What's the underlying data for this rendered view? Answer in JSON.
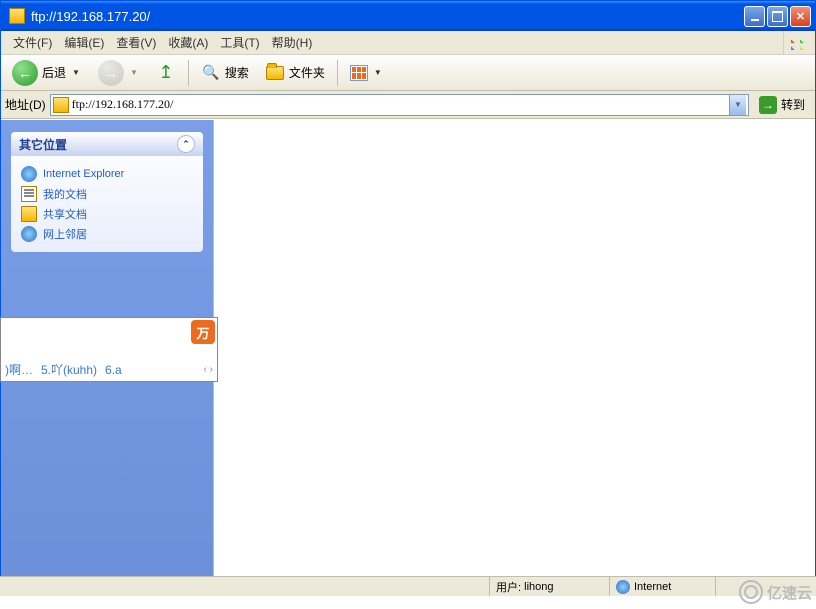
{
  "window": {
    "title": "ftp://192.168.177.20/"
  },
  "menu": {
    "file": "文件(F)",
    "edit": "编辑(E)",
    "view": "查看(V)",
    "fav": "收藏(A)",
    "tools": "工具(T)",
    "help": "帮助(H)"
  },
  "toolbar": {
    "back": "后退",
    "search": "搜索",
    "folders": "文件夹"
  },
  "address": {
    "label": "地址(D)",
    "value": "ftp://192.168.177.20/",
    "go": "转到"
  },
  "sidepanel": {
    "other_places": "其它位置",
    "links": {
      "ie": "Internet Explorer",
      "mydocs": "我的文档",
      "shared": "共享文档",
      "netnb": "网上邻居"
    }
  },
  "ime": {
    "logo": "万",
    "cand1": ")啊…",
    "cand2": "5.吖(kuhh)",
    "cand3": "6.a",
    "pager": "‹ ›"
  },
  "status": {
    "user_label": "用户:",
    "user_value": "lihong",
    "zone": "Internet"
  },
  "watermark": "亿速云"
}
